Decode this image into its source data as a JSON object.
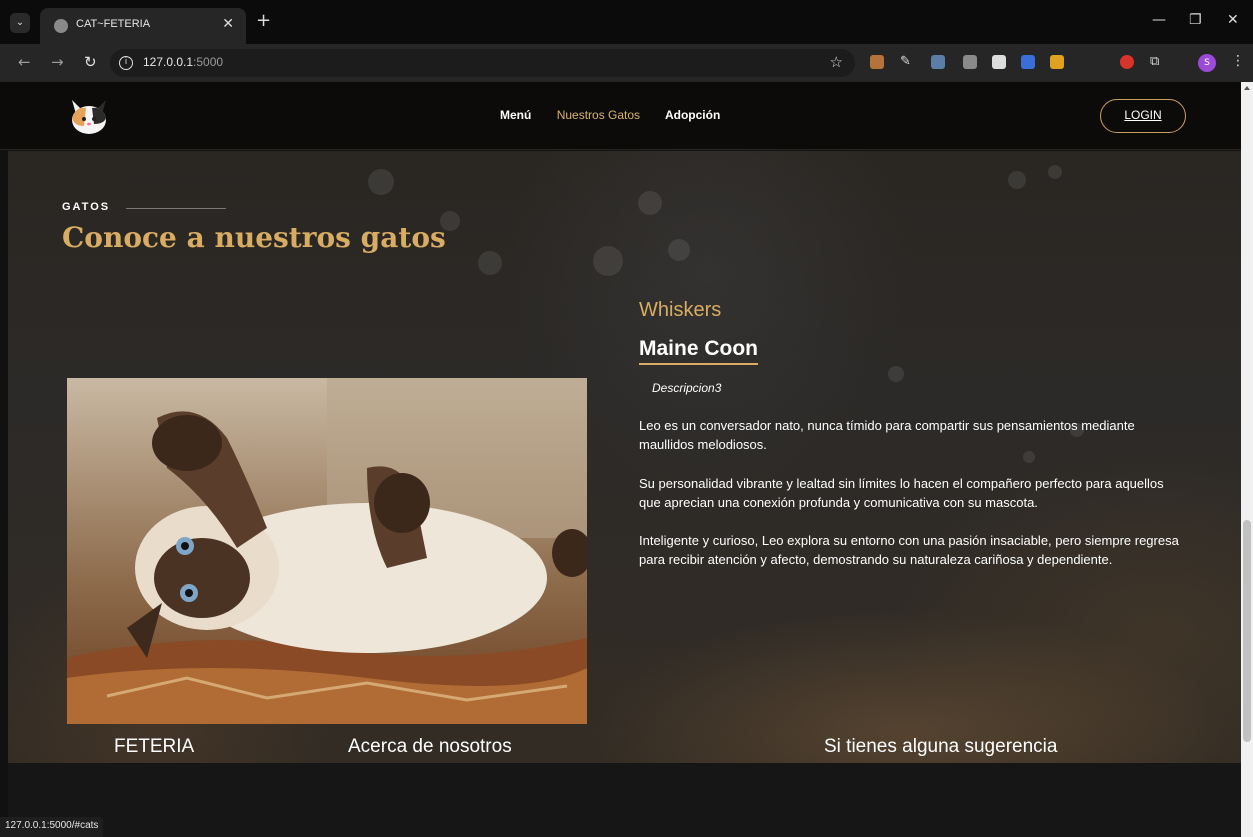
{
  "browser": {
    "tab_title": "CAT~FETERIA",
    "url_host": "127.0.0.1",
    "url_port": ":5000",
    "status_url": "127.0.0.1:5000/#cats",
    "profile_initial": "S"
  },
  "header": {
    "logo_name": "cat-logo",
    "nav": [
      "Menú",
      "Nuestros Gatos",
      "Adopción"
    ],
    "active_nav": "Nuestros Gatos",
    "login_label": "LOGIN"
  },
  "cats": {
    "eyebrow": "GATOS",
    "title": "Conoce a nuestros gatos",
    "name": "Whiskers",
    "breed": "Maine Coon",
    "desc_title": "Descripcion3",
    "paragraphs": [
      " Leo es un conversador nato, nunca tímido para compartir sus pensamientos mediante maullidos melodiosos.",
      " Su personalidad vibrante y lealtad sin límites lo hacen el compañero perfecto para aquellos que aprecian una conexión profunda y comunicativa con su mascota.",
      " Inteligente y curioso, Leo explora su entorno con una pasión insaciable, pero siempre regresa para recibir atención y afecto, demostrando su naturaleza cariñosa y dependiente."
    ],
    "carousel_active_index": 2,
    "carousel_count": 3
  },
  "footer": {
    "brand_partial": "FETERIA",
    "about": "Acerca de nosotros",
    "suggest": "Si tienes alguna sugerencia"
  },
  "colors": {
    "accent": "#d8ac63",
    "header_bg": "#0d0b09"
  }
}
